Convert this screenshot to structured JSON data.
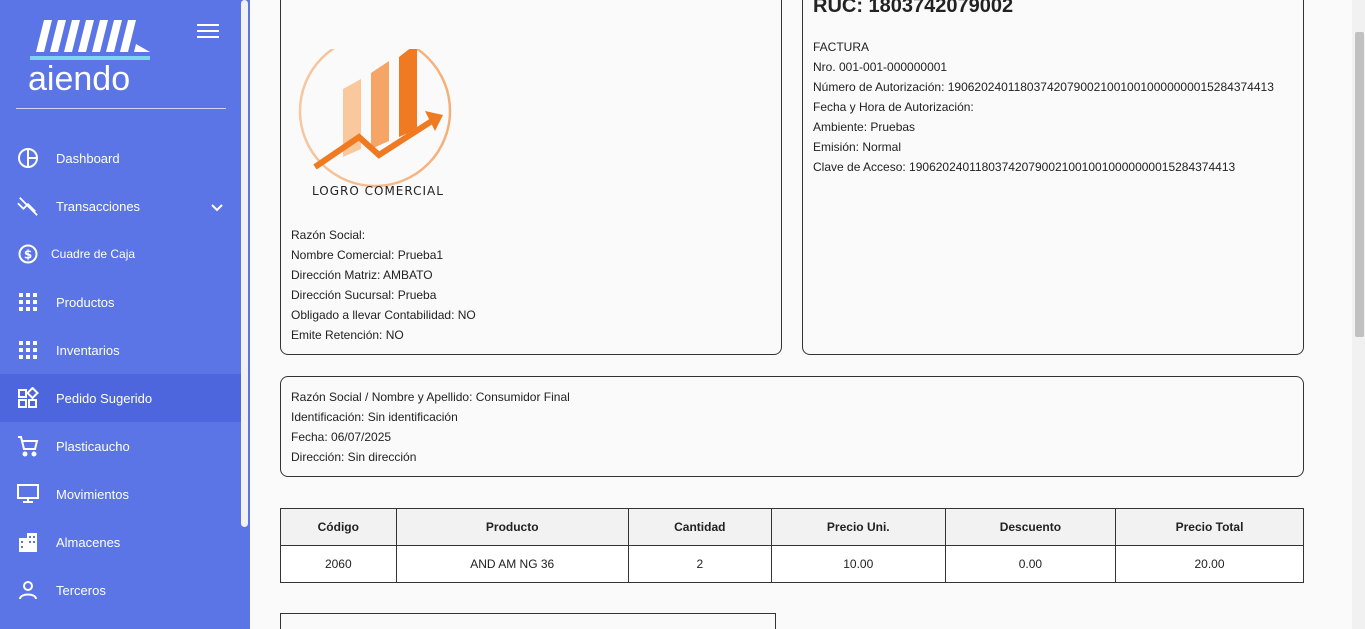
{
  "sidebar": {
    "brand": "aiendo",
    "items": [
      {
        "label": "Dashboard",
        "icon": "dashboard-icon"
      },
      {
        "label": "Transacciones",
        "icon": "transactions-icon"
      },
      {
        "label": "Cuadre de Caja",
        "icon": "dollar-icon"
      },
      {
        "label": "Productos",
        "icon": "grid-icon"
      },
      {
        "label": "Inventarios",
        "icon": "grid-icon"
      },
      {
        "label": "Pedido Sugerido",
        "icon": "widgets-icon"
      },
      {
        "label": "Plasticaucho",
        "icon": "cart-icon"
      },
      {
        "label": "Movimientos",
        "icon": "monitor-icon"
      },
      {
        "label": "Almacenes",
        "icon": "building-icon"
      },
      {
        "label": "Terceros",
        "icon": "person-icon"
      }
    ],
    "active": "Pedido Sugerido"
  },
  "issuer": {
    "logo_text": "LOGRO COMERCIAL",
    "lines": [
      "Razón Social:",
      "Nombre Comercial: Prueba1",
      "Dirección Matriz: AMBATO",
      "Dirección Sucursal: Prueba",
      "Obligado a llevar Contabilidad: NO",
      "Emite Retención: NO"
    ]
  },
  "invoice": {
    "ruc": "RUC: 1803742079002",
    "lines": [
      "FACTURA",
      "Nro. 001-001-000000001",
      "Número de Autorización: 1906202401180374207900210010010000000015284374413",
      "Fecha y Hora de Autorización:",
      "Ambiente: Pruebas",
      "Emisión: Normal",
      "Clave de Acceso: 1906202401180374207900210010010000000015284374413"
    ]
  },
  "client": {
    "lines": [
      "Razón Social / Nombre y Apellido: Consumidor Final",
      "Identificación: Sin identificación",
      "Fecha: 06/07/2025",
      "Dirección: Sin dirección"
    ]
  },
  "items_table": {
    "headers": [
      "Código",
      "Producto",
      "Cantidad",
      "Precio Uni.",
      "Descuento",
      "Precio Total"
    ],
    "rows": [
      [
        "2060",
        "AND AM NG 36",
        "2",
        "10.00",
        "0.00",
        "20.00"
      ]
    ]
  },
  "colors": {
    "sidebar": "#5b74e6",
    "sidebar_active": "#4d66de",
    "logo_orange": "#f07a22"
  }
}
